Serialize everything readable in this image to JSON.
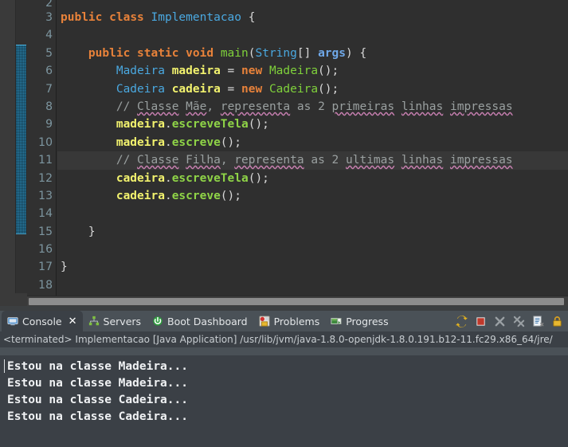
{
  "editor": {
    "first_partial_line": "2",
    "lines": [
      {
        "num": "3",
        "fold": false,
        "current": false,
        "tokens": [
          {
            "t": "public",
            "c": "k"
          },
          {
            "t": " ",
            "c": "pun"
          },
          {
            "t": "class",
            "c": "k"
          },
          {
            "t": " ",
            "c": "pun"
          },
          {
            "t": "Implementacao",
            "c": "typ"
          },
          {
            "t": " {",
            "c": "pun"
          }
        ]
      },
      {
        "num": "4",
        "fold": false,
        "current": false,
        "tokens": []
      },
      {
        "num": "5",
        "fold": true,
        "current": false,
        "tokens": [
          {
            "t": "    ",
            "c": "pun"
          },
          {
            "t": "public",
            "c": "k"
          },
          {
            "t": " ",
            "c": "pun"
          },
          {
            "t": "static",
            "c": "k"
          },
          {
            "t": " ",
            "c": "pun"
          },
          {
            "t": "void",
            "c": "k"
          },
          {
            "t": " ",
            "c": "pun"
          },
          {
            "t": "main",
            "c": "ctor"
          },
          {
            "t": "(",
            "c": "pun"
          },
          {
            "t": "String",
            "c": "typ"
          },
          {
            "t": "[] ",
            "c": "pun"
          },
          {
            "t": "args",
            "c": "prm"
          },
          {
            "t": ") {",
            "c": "pun"
          }
        ]
      },
      {
        "num": "6",
        "fold": false,
        "current": false,
        "tokens": [
          {
            "t": "        ",
            "c": "pun"
          },
          {
            "t": "Madeira",
            "c": "typ"
          },
          {
            "t": " ",
            "c": "pun"
          },
          {
            "t": "madeira",
            "c": "var"
          },
          {
            "t": " = ",
            "c": "pun"
          },
          {
            "t": "new",
            "c": "k"
          },
          {
            "t": " ",
            "c": "pun"
          },
          {
            "t": "Madeira",
            "c": "ctor"
          },
          {
            "t": "();",
            "c": "pun"
          }
        ]
      },
      {
        "num": "7",
        "fold": false,
        "current": false,
        "tokens": [
          {
            "t": "        ",
            "c": "pun"
          },
          {
            "t": "Cadeira",
            "c": "typ"
          },
          {
            "t": " ",
            "c": "pun"
          },
          {
            "t": "cadeira",
            "c": "var"
          },
          {
            "t": " = ",
            "c": "pun"
          },
          {
            "t": "new",
            "c": "k"
          },
          {
            "t": " ",
            "c": "pun"
          },
          {
            "t": "Cadeira",
            "c": "ctor"
          },
          {
            "t": "();",
            "c": "pun"
          }
        ]
      },
      {
        "num": "8",
        "fold": false,
        "current": false,
        "tokens": [
          {
            "t": "        ",
            "c": "pun"
          },
          {
            "t": "// ",
            "c": "cmt"
          },
          {
            "t": "Classe",
            "c": "cmt sp"
          },
          {
            "t": " ",
            "c": "cmt"
          },
          {
            "t": "Mãe",
            "c": "cmt sp"
          },
          {
            "t": ", ",
            "c": "cmt"
          },
          {
            "t": "representa",
            "c": "cmt sp"
          },
          {
            "t": " as 2 ",
            "c": "cmt"
          },
          {
            "t": "primeiras",
            "c": "cmt sp"
          },
          {
            "t": " ",
            "c": "cmt"
          },
          {
            "t": "linhas",
            "c": "cmt sp"
          },
          {
            "t": " ",
            "c": "cmt"
          },
          {
            "t": "impressas",
            "c": "cmt sp"
          }
        ]
      },
      {
        "num": "9",
        "fold": false,
        "current": false,
        "tokens": [
          {
            "t": "        ",
            "c": "pun"
          },
          {
            "t": "madeira",
            "c": "var"
          },
          {
            "t": ".",
            "c": "pun"
          },
          {
            "t": "escreveTela",
            "c": "mth"
          },
          {
            "t": "();",
            "c": "pun"
          }
        ]
      },
      {
        "num": "10",
        "fold": false,
        "current": false,
        "tokens": [
          {
            "t": "        ",
            "c": "pun"
          },
          {
            "t": "madeira",
            "c": "var"
          },
          {
            "t": ".",
            "c": "pun"
          },
          {
            "t": "escreve",
            "c": "mth"
          },
          {
            "t": "();",
            "c": "pun"
          }
        ]
      },
      {
        "num": "11",
        "fold": false,
        "current": true,
        "tokens": [
          {
            "t": "        ",
            "c": "pun"
          },
          {
            "t": "// ",
            "c": "cmt"
          },
          {
            "t": "Classe",
            "c": "cmt sp"
          },
          {
            "t": " ",
            "c": "cmt"
          },
          {
            "t": "Filha",
            "c": "cmt sp"
          },
          {
            "t": ", ",
            "c": "cmt"
          },
          {
            "t": "representa",
            "c": "cmt sp"
          },
          {
            "t": " as 2 ",
            "c": "cmt"
          },
          {
            "t": "ultimas",
            "c": "cmt sp"
          },
          {
            "t": " ",
            "c": "cmt"
          },
          {
            "t": "linhas",
            "c": "cmt sp"
          },
          {
            "t": " ",
            "c": "cmt"
          },
          {
            "t": "impressas",
            "c": "cmt sp"
          }
        ]
      },
      {
        "num": "12",
        "fold": false,
        "current": false,
        "tokens": [
          {
            "t": "        ",
            "c": "pun"
          },
          {
            "t": "cadeira",
            "c": "var"
          },
          {
            "t": ".",
            "c": "pun"
          },
          {
            "t": "escreveTela",
            "c": "mth"
          },
          {
            "t": "();",
            "c": "pun"
          }
        ]
      },
      {
        "num": "13",
        "fold": false,
        "current": false,
        "tokens": [
          {
            "t": "        ",
            "c": "pun"
          },
          {
            "t": "cadeira",
            "c": "var"
          },
          {
            "t": ".",
            "c": "pun"
          },
          {
            "t": "escreve",
            "c": "mth"
          },
          {
            "t": "();",
            "c": "pun"
          }
        ]
      },
      {
        "num": "14",
        "fold": false,
        "current": false,
        "tokens": []
      },
      {
        "num": "15",
        "fold": false,
        "current": false,
        "tokens": [
          {
            "t": "    }",
            "c": "pun"
          }
        ]
      },
      {
        "num": "16",
        "fold": false,
        "current": false,
        "tokens": []
      },
      {
        "num": "17",
        "fold": false,
        "current": false,
        "tokens": [
          {
            "t": "}",
            "c": "pun"
          }
        ]
      },
      {
        "num": "18",
        "fold": false,
        "current": false,
        "tokens": []
      }
    ]
  },
  "panel": {
    "tabs": [
      {
        "label": "Console",
        "icon": "console-icon",
        "active": true,
        "closable": true
      },
      {
        "label": "Servers",
        "icon": "servers-icon",
        "active": false,
        "closable": false
      },
      {
        "label": "Boot Dashboard",
        "icon": "boot-dashboard-icon",
        "active": false,
        "closable": false
      },
      {
        "label": "Problems",
        "icon": "problems-icon",
        "active": false,
        "closable": false
      },
      {
        "label": "Progress",
        "icon": "progress-icon",
        "active": false,
        "closable": false
      }
    ],
    "toolbar": [
      {
        "name": "relaunch-icon",
        "title": "Relaunch"
      },
      {
        "name": "terminate-icon",
        "title": "Terminate"
      },
      {
        "name": "remove-launch-icon",
        "title": "Remove Launch"
      },
      {
        "name": "remove-all-icon",
        "title": "Remove All Terminated Launches"
      },
      {
        "name": "clear-console-icon",
        "title": "Clear Console"
      },
      {
        "name": "scroll-lock-icon",
        "title": "Scroll Lock"
      }
    ],
    "terminated_line": "<terminated> Implementacao [Java Application] /usr/lib/jvm/java-1.8.0-openjdk-1.8.0.191.b12-11.fc29.x86_64/jre/",
    "output": [
      "Estou na classe Madeira...",
      "Estou na classe Madeira...",
      "Estou na classe Cadeira...",
      "Estou na classe Cadeira..."
    ]
  },
  "colors": {
    "editor_bg": "#2f2f2f",
    "current_line_bg": "#383838",
    "gutter_bg": "#313131",
    "keyword": "#e8823a",
    "type": "#4aa8e0",
    "method": "#8fd447",
    "variable": "#f2f26e",
    "comment": "#9aa0a0",
    "spell_underline": "#c77fb0",
    "panel_bg": "#4a5157",
    "console_bg": "#3b4046",
    "method_range": "#2a7fa8"
  }
}
